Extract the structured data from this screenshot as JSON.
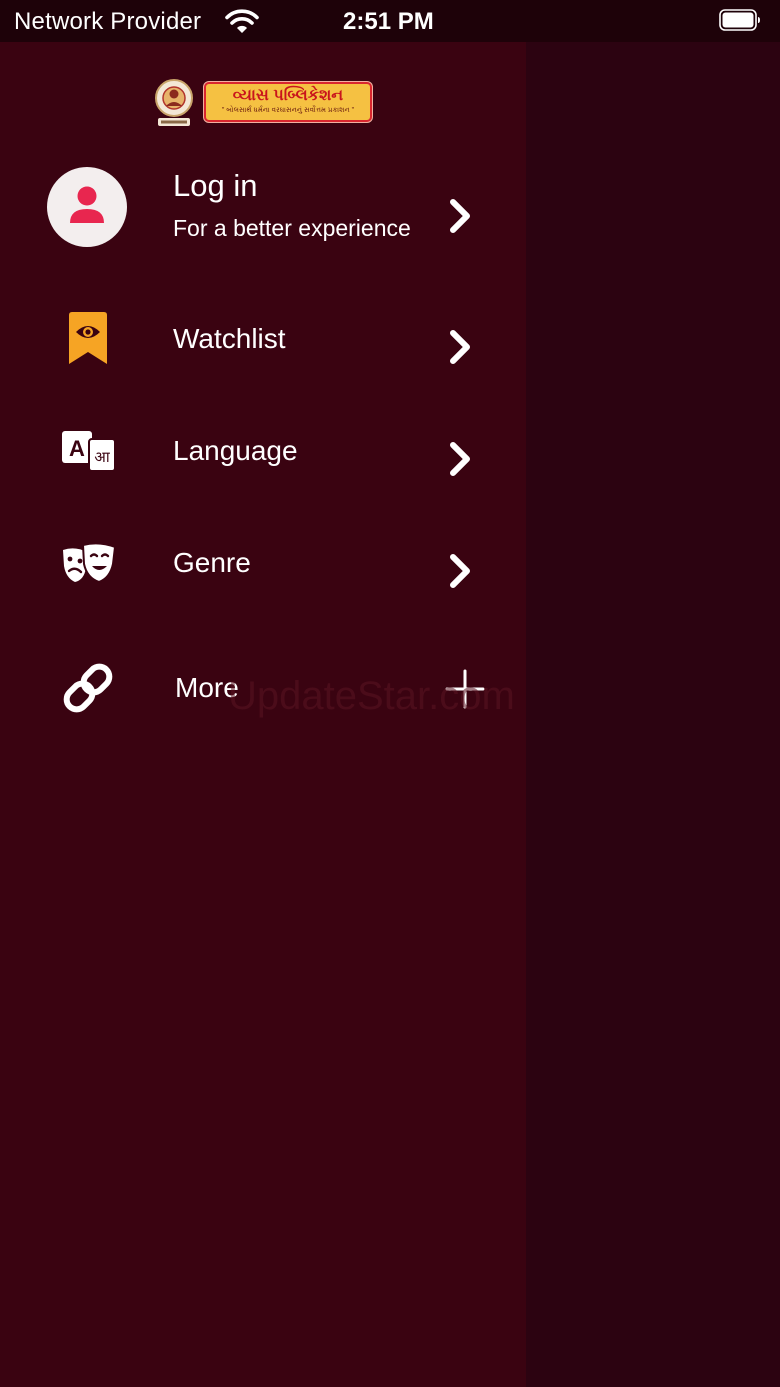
{
  "status_bar": {
    "carrier": "Network Provider",
    "time": "2:51 PM",
    "wifi_icon": "wifi-icon",
    "battery_icon": "battery-icon"
  },
  "logo": {
    "title": "વ્યાસ પબ્લિકેશન",
    "subtitle": "\" બોલસાર્થ ધર્મના વરઘાસનનું સર્વોત્તમ પ્રકાશન \""
  },
  "menu": {
    "login": {
      "label": "Log in",
      "sublabel": "For a better experience",
      "icon": "user-avatar-icon"
    },
    "watchlist": {
      "label": "Watchlist",
      "icon": "bookmark-eye-icon"
    },
    "language": {
      "label": "Language",
      "icon": "translate-icon"
    },
    "genre": {
      "label": "Genre",
      "icon": "theater-masks-icon"
    },
    "more": {
      "label": "More",
      "icon": "link-icon",
      "expand_icon": "plus-icon"
    }
  },
  "watermark": "UpdateStar.com",
  "colors": {
    "drawer_bg": "#3a0311",
    "backdrop": "#2c0311",
    "avatar_accent": "#e8264f",
    "watchlist_accent": "#f6a424"
  }
}
